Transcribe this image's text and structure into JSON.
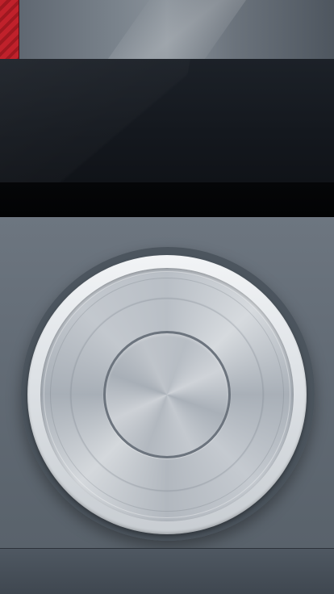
{
  "header": {
    "accent_color": "#c0212b",
    "icon": "red-striped-tab"
  },
  "display": {
    "screen_text": ""
  },
  "controls": {
    "wheel": {
      "icon": "click-wheel",
      "center_button_icon": "center-select-button"
    }
  }
}
